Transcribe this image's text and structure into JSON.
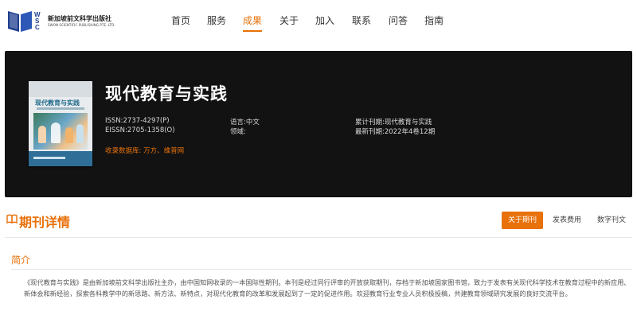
{
  "brand": {
    "name_cn": "新加坡前文科学出版社",
    "name_en": "SWON SCIENTIFIC PUBLISHING PTE. LTD."
  },
  "nav": {
    "items": [
      {
        "label": "首页"
      },
      {
        "label": "服务"
      },
      {
        "label": "成果",
        "active": true
      },
      {
        "label": "关于"
      },
      {
        "label": "加入"
      },
      {
        "label": "联系"
      },
      {
        "label": "问答"
      },
      {
        "label": "指南"
      }
    ]
  },
  "journal": {
    "cover_title": "现代教育与实践",
    "title": "现代教育与实践",
    "issn_p": "ISSN:2737-4297(P)",
    "issn_o": "EISSN:2705-1358(O)",
    "language": "语言:中文",
    "field": "领域:",
    "cumulative": "累计刊期:现代教育与实践",
    "latest": "最新刊期:2022年4卷12期",
    "databases": "收录数据库:  万方、维普网"
  },
  "section": {
    "title": "期刊详情",
    "tabs": [
      {
        "label": "关于期刊",
        "active": true
      },
      {
        "label": "发表费用"
      },
      {
        "label": "数字刊文"
      }
    ]
  },
  "intro": {
    "label": "简介",
    "text": "《现代教育与实践》是由新加坡前文科学出版社主办，由中国知网收录的一本国际性期刊。本刊是经过同行评审的开放获取期刊，存档于新加坡国家图书馆，致力于发表有关现代科学技术在教育过程中的新应用、新体会和新经验，探索各科教学中的新思路、新方法、新特点，对现代化教育的改革和发展起到了一定的促进作用。欢迎教育行业专业人员积极投稿，共建教育领域研究发展的良好交流平台。"
  },
  "colors": {
    "accent": "#e8710a",
    "hero_bg": "#121212",
    "brand_blue": "#1f3f8f"
  }
}
